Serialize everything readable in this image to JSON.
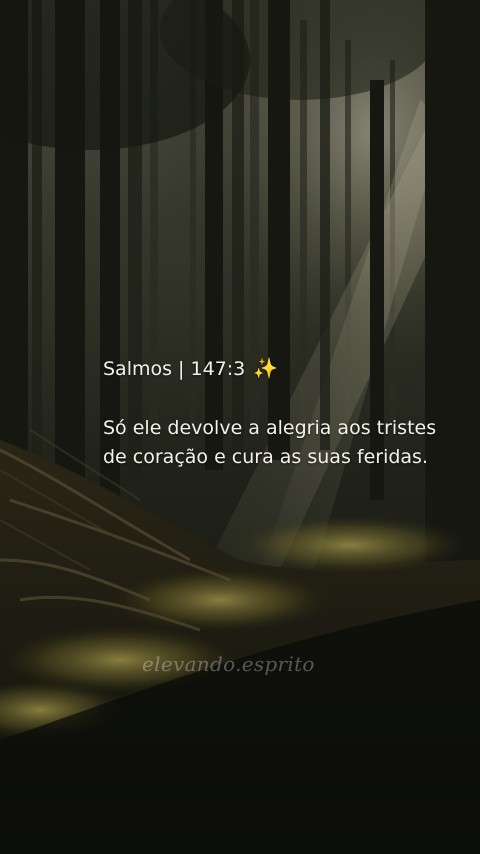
{
  "post": {
    "reference": "Salmos | 147:3",
    "sparkle": "✨",
    "verse": "Só ele devolve a alegria aos tristes de coração e cura as suas feridas."
  },
  "watermark": "elevando.esprito",
  "background": {
    "subject": "forest-with-sunbeams",
    "colors": {
      "shadow": "#151a12",
      "haze": "#b9b7a2",
      "sunlit_moss": "#c8b85a"
    }
  }
}
